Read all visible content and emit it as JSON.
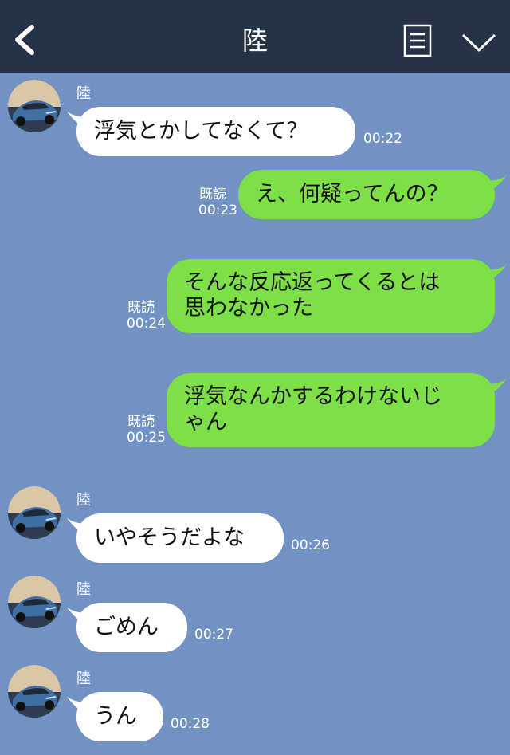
{
  "header": {
    "title": "陸"
  },
  "messages": [
    {
      "side": "in",
      "sender": "陸",
      "text": "浮気とかしてなくて？",
      "time": "00:22"
    },
    {
      "side": "out",
      "read": "既読",
      "text": "え、何疑ってんの？",
      "time": "00:23"
    },
    {
      "side": "out",
      "read": "既読",
      "text_lines": [
        "そんな反応返ってくるとは",
        "思わなかった"
      ],
      "time": "00:24"
    },
    {
      "side": "out",
      "read": "既読",
      "text_lines": [
        "浮気なんかするわけないじ",
        "ゃん"
      ],
      "time": "00:25"
    },
    {
      "side": "in",
      "sender": "陸",
      "text": "いやそうだよな",
      "time": "00:26"
    },
    {
      "side": "in",
      "sender": "陸",
      "text": "ごめん",
      "time": "00:27"
    },
    {
      "side": "in",
      "sender": "陸",
      "text": "うん",
      "time": "00:28"
    }
  ],
  "icons": [
    "back-chevron-icon",
    "note-icon",
    "chevron-down-icon",
    "car-avatar"
  ],
  "colors": {
    "header": "#253248",
    "background": "#7192c2",
    "incoming_bubble": "#ffffff",
    "outgoing_bubble": "#7ee047"
  }
}
